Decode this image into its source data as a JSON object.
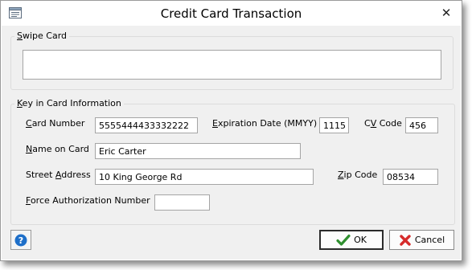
{
  "window": {
    "title": "Credit Card Transaction"
  },
  "swipe": {
    "legend_key": "S",
    "legend_rest": "wipe Card",
    "value": ""
  },
  "key_in": {
    "legend_key": "K",
    "legend_rest": "ey in Card Information"
  },
  "fields": {
    "card_number": {
      "label_key": "C",
      "label_rest": "ard Number",
      "value": "5555444433332222"
    },
    "expiration": {
      "label_key": "E",
      "label_rest": "xpiration Date (MMYY)",
      "value": "1115"
    },
    "cv_code": {
      "label_pre": "C",
      "label_key": "V",
      "label_rest": " Code",
      "value": "456"
    },
    "name": {
      "label_key": "N",
      "label_rest": "ame on Card",
      "value": "Eric Carter"
    },
    "street": {
      "label_pre": "Street ",
      "label_key": "A",
      "label_rest": "ddress",
      "value": "10 King George Rd"
    },
    "zip": {
      "label_key": "Z",
      "label_rest": "ip Code",
      "value": "08534"
    },
    "force_auth": {
      "label_key": "F",
      "label_rest": "orce Authorization Number",
      "value": ""
    }
  },
  "buttons": {
    "ok": "OK",
    "cancel": "Cancel"
  },
  "icons": {
    "help": "help-icon",
    "ok": "checkmark-icon",
    "cancel": "red-x-icon",
    "close": "close-icon"
  },
  "colors": {
    "help_blue": "#1e6fc9",
    "ok_green": "#2f8f2f",
    "cancel_red": "#d62b2b"
  }
}
